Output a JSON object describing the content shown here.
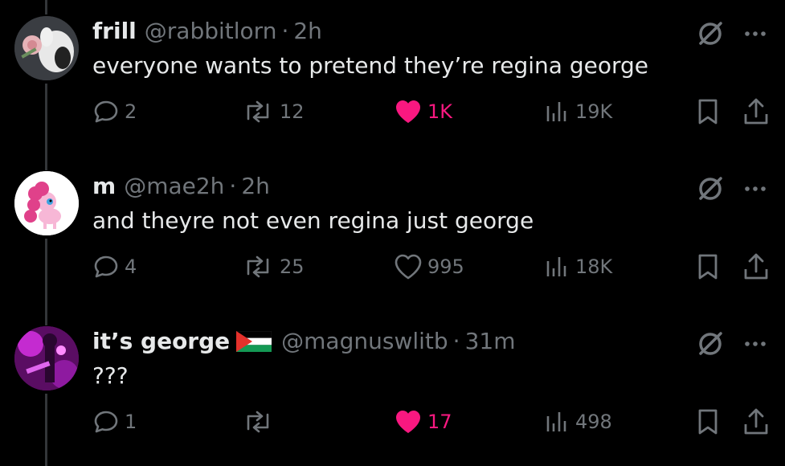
{
  "tweets": [
    {
      "name": "frill",
      "handle": "@rabbitlorn",
      "time": "2h",
      "text": "everyone wants to pretend they’re regina george",
      "has_flag": false,
      "replies": "2",
      "reposts": "12",
      "likes": "1K",
      "liked": true,
      "views": "19K"
    },
    {
      "name": "m",
      "handle": "@mae2h",
      "time": "2h",
      "text": "and theyre not even regina just george",
      "has_flag": false,
      "replies": "4",
      "reposts": "25",
      "likes": "995",
      "liked": false,
      "views": "18K"
    },
    {
      "name": "it’s george",
      "handle": "@magnuswlitb",
      "time": "31m",
      "text": "???",
      "has_flag": true,
      "replies": "1",
      "reposts": "",
      "likes": "17",
      "liked": true,
      "views": "498"
    }
  ],
  "colors": {
    "background": "#000000",
    "text": "#e7e9ea",
    "muted": "#71767b",
    "like_active": "#f91880",
    "thread_line": "#333639"
  },
  "icons": [
    "reply-icon",
    "repost-icon",
    "like-icon",
    "views-icon",
    "bookmark-icon",
    "share-icon",
    "grok-icon",
    "more-icon"
  ]
}
